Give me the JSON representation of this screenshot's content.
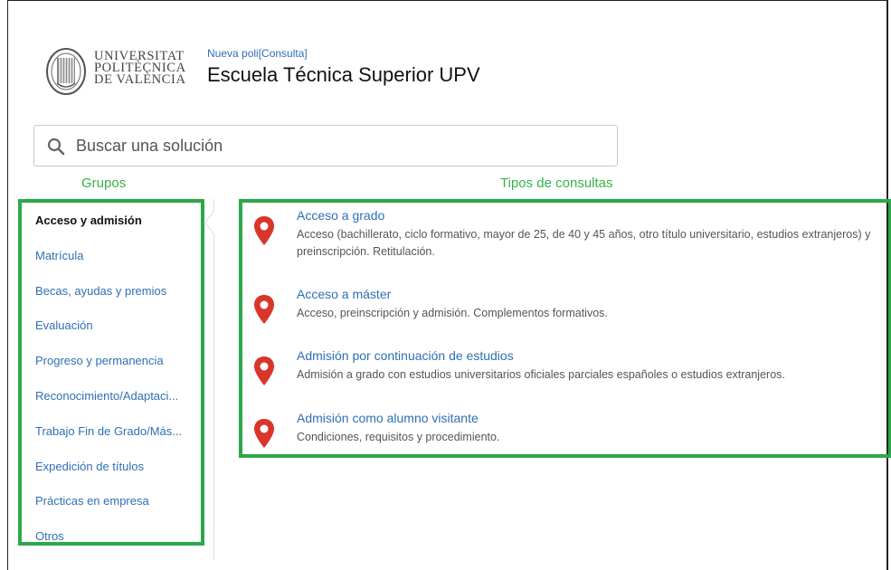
{
  "header": {
    "logo_lines": [
      "UNIVERSITAT",
      "POLITÈCNICA",
      "DE VALÈNCIA"
    ],
    "breadcrumb": "Nueva poli[Consulta]",
    "title": "Escuela Técnica Superior UPV"
  },
  "search": {
    "placeholder": "Buscar una solución"
  },
  "groups": {
    "heading": "Grupos",
    "items": [
      {
        "label": "Acceso y admisión",
        "active": true
      },
      {
        "label": "Matrícula"
      },
      {
        "label": "Becas, ayudas y premios"
      },
      {
        "label": "Evaluación"
      },
      {
        "label": "Progreso y permanencia"
      },
      {
        "label": "Reconocimiento/Adaptaci..."
      },
      {
        "label": "Trabajo Fin de Grado/Más..."
      },
      {
        "label": "Expedición de títulos"
      },
      {
        "label": "Prácticas en empresa"
      },
      {
        "label": "Otros"
      }
    ]
  },
  "types": {
    "heading": "Tipos de consultas",
    "items": [
      {
        "title": "Acceso a grado",
        "desc": "Acceso (bachillerato, ciclo formativo, mayor de 25, de 40 y 45 años, otro título universitario, estudios extranjeros) y preinscripción. Retitulación."
      },
      {
        "title": "Acceso a máster",
        "desc": "Acceso, preinscripción y admisión. Complementos formativos."
      },
      {
        "title": "Admisión por continuación de estudios",
        "desc": "Admisión a grado con estudios universitarios oficiales parciales españoles o estudios extranjeros."
      },
      {
        "title": "Admisión como alumno visitante",
        "desc": "Condiciones, requisitos y procedimiento."
      }
    ]
  },
  "colors": {
    "accent_green": "#2ca84a",
    "link_blue": "#2f6fb3",
    "pin_red": "#d9362b"
  },
  "icons": {
    "search": "search-icon",
    "pin": "map-pin-icon",
    "logo": "upv-seal-icon"
  }
}
